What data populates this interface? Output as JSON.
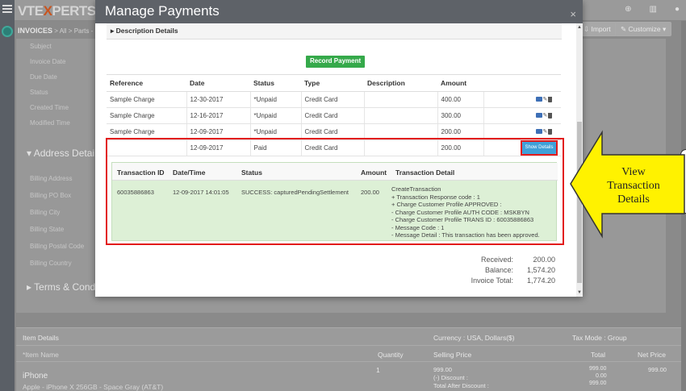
{
  "app": {
    "logo_prefix": "VTE",
    "logo_x": "X",
    "logo_suffix": "PERTS",
    "breadcrumb_module": "INVOICES",
    "breadcrumb_path": " > All > Parts - Sa",
    "import_label": "Import",
    "customize_label": "Customize",
    "fields": [
      "Subject",
      "Invoice Date",
      "Due Date",
      "Status",
      "Created Time",
      "Modified Time"
    ],
    "address_title": "Address Details",
    "address_fields": [
      "Billing Address",
      "Billing PO Box",
      "Billing City",
      "Billing State",
      "Billing Postal Code",
      "Billing Country"
    ],
    "terms_title": "Terms & Conditions",
    "items": {
      "header_label": "Item Details",
      "currency_label": "Currency : USA, Dollars($)",
      "tax_mode_label": "Tax Mode : Group",
      "col_item_name": "*Item Name",
      "col_quantity": "Quantity",
      "col_selling_price": "Selling Price",
      "col_total": "Total",
      "col_net_price": "Net Price",
      "row_name": "iPhone",
      "row_sub": "Apple - iPhone X 256GB - Space Gray (AT&T)",
      "row_qty": "1",
      "row_price": "999.00",
      "row_discount": "(-) Discount :",
      "row_after_discount": "Total After Discount :",
      "row_total_1": "999.00",
      "row_total_2": "0.00",
      "row_total_3": "999.00",
      "row_net": "999.00"
    }
  },
  "modal": {
    "title": "Manage Payments",
    "close_glyph": "×",
    "description_toggle": "▸ Description Details",
    "record_payment_label": "Record Payment",
    "columns": [
      "Reference",
      "Date",
      "Status",
      "Type",
      "Description",
      "Amount"
    ],
    "payments": [
      {
        "reference": "Sample Charge",
        "date": "12-30-2017",
        "status": "*Unpaid",
        "type": "Credit Card",
        "description": "",
        "amount": "400.00"
      },
      {
        "reference": "Sample Charge",
        "date": "12-16-2017",
        "status": "*Unpaid",
        "type": "Credit Card",
        "description": "",
        "amount": "300.00"
      },
      {
        "reference": "Sample Charge",
        "date": "12-09-2017",
        "status": "*Unpaid",
        "type": "Credit Card",
        "description": "",
        "amount": "200.00"
      },
      {
        "reference": "",
        "date": "12-09-2017",
        "status": "Paid",
        "type": "Credit Card",
        "description": "",
        "amount": "200.00"
      }
    ],
    "show_details_label": "Show Details",
    "transaction": {
      "columns": [
        "Transaction ID",
        "Date/Time",
        "Status",
        "Amount",
        "Transaction Detail"
      ],
      "id": "60035886863",
      "datetime": "12-09-2017 14:01:05",
      "status": "SUCCESS: capturedPendingSettlement",
      "amount": "200.00",
      "detail_lines": [
        "CreateTransaction",
        "+ Transaction Response code : 1",
        "+ Charge Customer Profile APPROVED :",
        "- Charge Customer Profile AUTH CODE : MSKBYN",
        "- Charge Customer Profile TRANS ID : 60035886863",
        "- Message Code : 1",
        "- Message Detail : This transaction has been approved."
      ]
    },
    "totals": {
      "received_label": "Received:",
      "received_value": "200.00",
      "balance_label": "Balance:",
      "balance_value": "1,574.20",
      "invoice_total_label": "Invoice Total:",
      "invoice_total_value": "1,774.20"
    }
  },
  "callout": {
    "line1": "View",
    "line2": "Transaction",
    "line3": "Details",
    "fill_color": "#fff200",
    "stroke_color": "#333333"
  },
  "colors": {
    "modal_header": "#5e6268",
    "record_button": "#35a94a",
    "show_details_button": "#3fa0d8",
    "highlight_border": "#e21b1b",
    "transaction_bg": "#ddf0d6"
  }
}
